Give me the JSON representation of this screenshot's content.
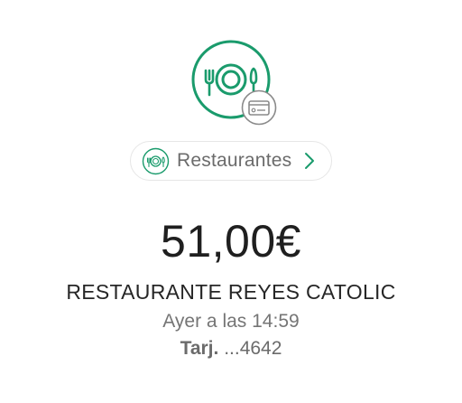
{
  "category": {
    "label": "Restaurantes",
    "icon": "restaurant-plate-icon",
    "badge_icon": "credit-card-icon",
    "chevron_icon": "chevron-right-icon",
    "accent_color": "#1a9b6c",
    "badge_color": "#8a8a8a"
  },
  "transaction": {
    "amount": "51,00€",
    "merchant": "RESTAURANTE REYES CATOLIC",
    "datetime": "Ayer a las 14:59",
    "card_prefix": "Tarj.",
    "card_number": " ...4642"
  }
}
